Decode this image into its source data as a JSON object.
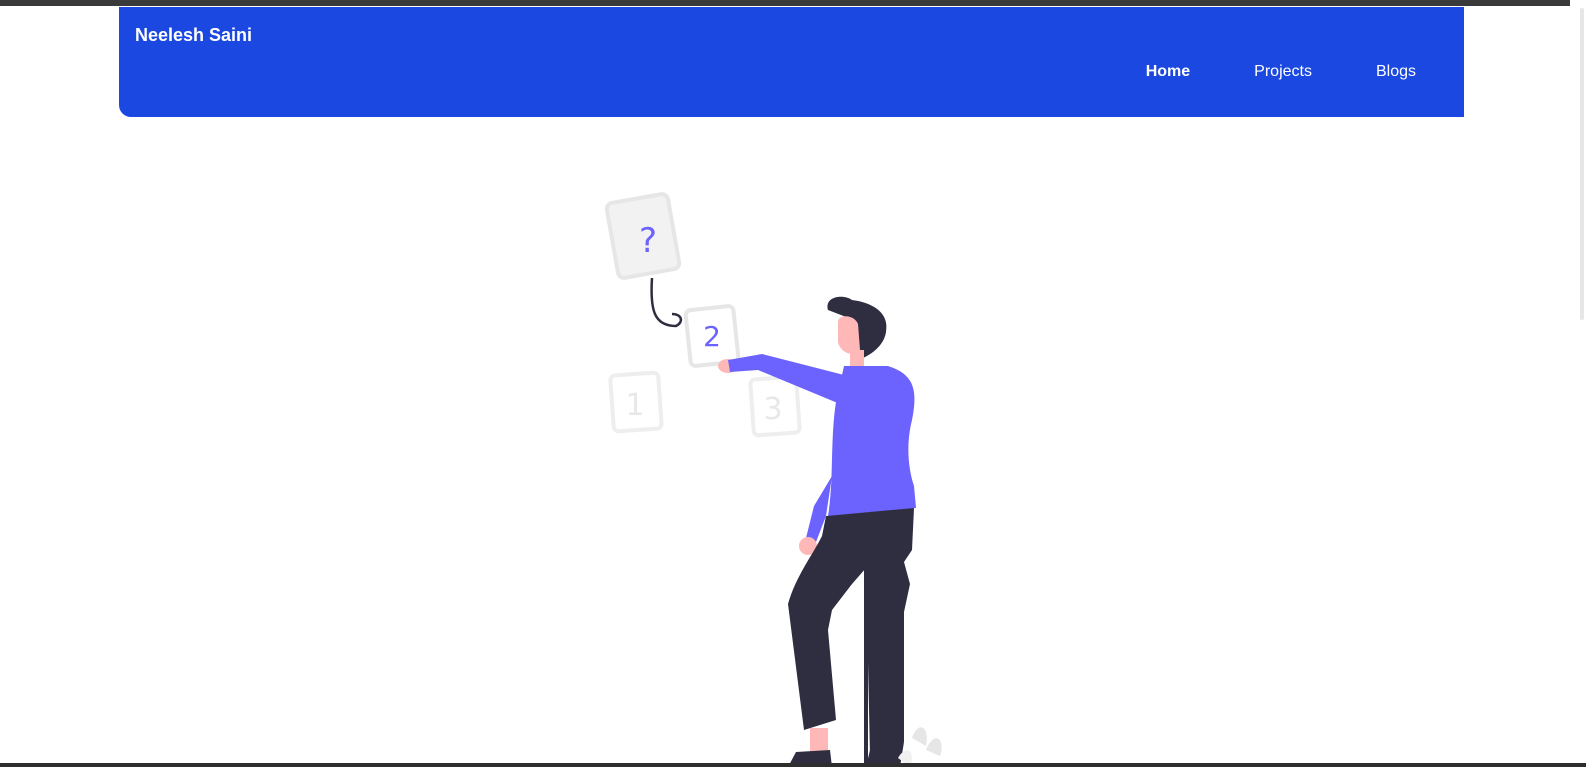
{
  "navbar": {
    "brand": "Neelesh Saini",
    "links": [
      {
        "label": "Home",
        "active": true
      },
      {
        "label": "Projects",
        "active": false
      },
      {
        "label": "Blogs",
        "active": false
      }
    ],
    "background_color": "#1b48e0"
  },
  "illustration": {
    "cards": [
      {
        "glyph": "?"
      },
      {
        "glyph": "2"
      },
      {
        "glyph": "1"
      },
      {
        "glyph": "3"
      }
    ],
    "accent_color": "#6c63ff",
    "dark_color": "#2f2e41",
    "skin_color": "#ffb8b8"
  }
}
